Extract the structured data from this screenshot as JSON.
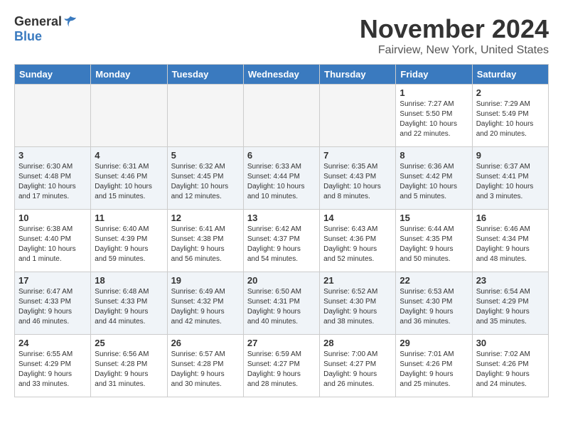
{
  "logo": {
    "general": "General",
    "blue": "Blue"
  },
  "title": "November 2024",
  "location": "Fairview, New York, United States",
  "days_of_week": [
    "Sunday",
    "Monday",
    "Tuesday",
    "Wednesday",
    "Thursday",
    "Friday",
    "Saturday"
  ],
  "weeks": [
    [
      {
        "day": "",
        "info": ""
      },
      {
        "day": "",
        "info": ""
      },
      {
        "day": "",
        "info": ""
      },
      {
        "day": "",
        "info": ""
      },
      {
        "day": "",
        "info": ""
      },
      {
        "day": "1",
        "info": "Sunrise: 7:27 AM\nSunset: 5:50 PM\nDaylight: 10 hours\nand 22 minutes."
      },
      {
        "day": "2",
        "info": "Sunrise: 7:29 AM\nSunset: 5:49 PM\nDaylight: 10 hours\nand 20 minutes."
      }
    ],
    [
      {
        "day": "3",
        "info": "Sunrise: 6:30 AM\nSunset: 4:48 PM\nDaylight: 10 hours\nand 17 minutes."
      },
      {
        "day": "4",
        "info": "Sunrise: 6:31 AM\nSunset: 4:46 PM\nDaylight: 10 hours\nand 15 minutes."
      },
      {
        "day": "5",
        "info": "Sunrise: 6:32 AM\nSunset: 4:45 PM\nDaylight: 10 hours\nand 12 minutes."
      },
      {
        "day": "6",
        "info": "Sunrise: 6:33 AM\nSunset: 4:44 PM\nDaylight: 10 hours\nand 10 minutes."
      },
      {
        "day": "7",
        "info": "Sunrise: 6:35 AM\nSunset: 4:43 PM\nDaylight: 10 hours\nand 8 minutes."
      },
      {
        "day": "8",
        "info": "Sunrise: 6:36 AM\nSunset: 4:42 PM\nDaylight: 10 hours\nand 5 minutes."
      },
      {
        "day": "9",
        "info": "Sunrise: 6:37 AM\nSunset: 4:41 PM\nDaylight: 10 hours\nand 3 minutes."
      }
    ],
    [
      {
        "day": "10",
        "info": "Sunrise: 6:38 AM\nSunset: 4:40 PM\nDaylight: 10 hours\nand 1 minute."
      },
      {
        "day": "11",
        "info": "Sunrise: 6:40 AM\nSunset: 4:39 PM\nDaylight: 9 hours\nand 59 minutes."
      },
      {
        "day": "12",
        "info": "Sunrise: 6:41 AM\nSunset: 4:38 PM\nDaylight: 9 hours\nand 56 minutes."
      },
      {
        "day": "13",
        "info": "Sunrise: 6:42 AM\nSunset: 4:37 PM\nDaylight: 9 hours\nand 54 minutes."
      },
      {
        "day": "14",
        "info": "Sunrise: 6:43 AM\nSunset: 4:36 PM\nDaylight: 9 hours\nand 52 minutes."
      },
      {
        "day": "15",
        "info": "Sunrise: 6:44 AM\nSunset: 4:35 PM\nDaylight: 9 hours\nand 50 minutes."
      },
      {
        "day": "16",
        "info": "Sunrise: 6:46 AM\nSunset: 4:34 PM\nDaylight: 9 hours\nand 48 minutes."
      }
    ],
    [
      {
        "day": "17",
        "info": "Sunrise: 6:47 AM\nSunset: 4:33 PM\nDaylight: 9 hours\nand 46 minutes."
      },
      {
        "day": "18",
        "info": "Sunrise: 6:48 AM\nSunset: 4:33 PM\nDaylight: 9 hours\nand 44 minutes."
      },
      {
        "day": "19",
        "info": "Sunrise: 6:49 AM\nSunset: 4:32 PM\nDaylight: 9 hours\nand 42 minutes."
      },
      {
        "day": "20",
        "info": "Sunrise: 6:50 AM\nSunset: 4:31 PM\nDaylight: 9 hours\nand 40 minutes."
      },
      {
        "day": "21",
        "info": "Sunrise: 6:52 AM\nSunset: 4:30 PM\nDaylight: 9 hours\nand 38 minutes."
      },
      {
        "day": "22",
        "info": "Sunrise: 6:53 AM\nSunset: 4:30 PM\nDaylight: 9 hours\nand 36 minutes."
      },
      {
        "day": "23",
        "info": "Sunrise: 6:54 AM\nSunset: 4:29 PM\nDaylight: 9 hours\nand 35 minutes."
      }
    ],
    [
      {
        "day": "24",
        "info": "Sunrise: 6:55 AM\nSunset: 4:29 PM\nDaylight: 9 hours\nand 33 minutes."
      },
      {
        "day": "25",
        "info": "Sunrise: 6:56 AM\nSunset: 4:28 PM\nDaylight: 9 hours\nand 31 minutes."
      },
      {
        "day": "26",
        "info": "Sunrise: 6:57 AM\nSunset: 4:28 PM\nDaylight: 9 hours\nand 30 minutes."
      },
      {
        "day": "27",
        "info": "Sunrise: 6:59 AM\nSunset: 4:27 PM\nDaylight: 9 hours\nand 28 minutes."
      },
      {
        "day": "28",
        "info": "Sunrise: 7:00 AM\nSunset: 4:27 PM\nDaylight: 9 hours\nand 26 minutes."
      },
      {
        "day": "29",
        "info": "Sunrise: 7:01 AM\nSunset: 4:26 PM\nDaylight: 9 hours\nand 25 minutes."
      },
      {
        "day": "30",
        "info": "Sunrise: 7:02 AM\nSunset: 4:26 PM\nDaylight: 9 hours\nand 24 minutes."
      }
    ]
  ]
}
